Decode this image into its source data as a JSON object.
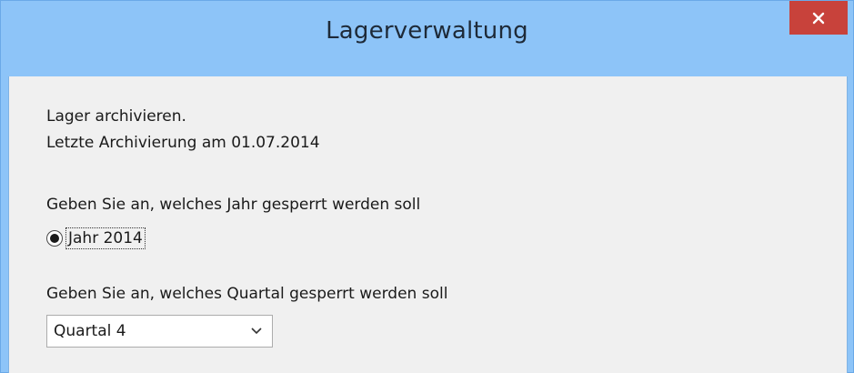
{
  "window": {
    "title": "Lagerverwaltung",
    "close_icon": "close-icon"
  },
  "content": {
    "line1": "Lager archivieren.",
    "line2": "Letzte Archivierung am 01.07.2014",
    "year_prompt": "Geben Sie an, welches Jahr gesperrt werden soll",
    "year_option": {
      "label": "Jahr 2014",
      "selected": true
    },
    "quarter_prompt": "Geben Sie an, welches Quartal gesperrt werden soll",
    "quarter_select": {
      "value": "Quartal 4",
      "arrow_icon": "chevron-down-icon"
    }
  },
  "colors": {
    "titlebar": "#8dc4f8",
    "close_button": "#c8423b",
    "client_background": "#f0f0f0"
  }
}
